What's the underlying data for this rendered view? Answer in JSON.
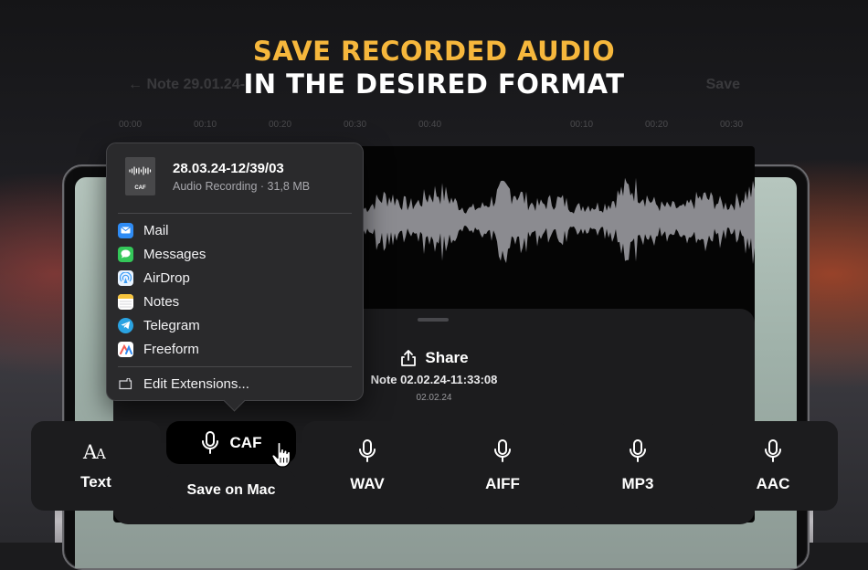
{
  "headline": {
    "line1": "SAVE RECORDED AUDIO",
    "line2": "IN THE DESIRED FORMAT"
  },
  "topbar": {
    "back_label": "← Note 29.01.24-",
    "save_label": "Save"
  },
  "timeline": [
    "00:00",
    "00:10",
    "00:20",
    "00:30",
    "00:40",
    "00:10",
    "00:20",
    "00:30"
  ],
  "sheet": {
    "share_label": "Share",
    "note_title": "Note 02.02.24-11:33:08",
    "note_date": "02.02.24"
  },
  "popover": {
    "file_name": "28.03.24-12/39/03",
    "file_meta": "Audio Recording · 31,8 MB",
    "file_ext": "CAF",
    "items": [
      {
        "label": "Mail",
        "icon": "mail-icon",
        "color": "#2f8cf5"
      },
      {
        "label": "Messages",
        "icon": "messages-icon",
        "color": "#34c759"
      },
      {
        "label": "AirDrop",
        "icon": "airdrop-icon",
        "color": "#3b9cf5"
      },
      {
        "label": "Notes",
        "icon": "notes-icon",
        "color": "#f6c33c"
      },
      {
        "label": "Telegram",
        "icon": "telegram-icon",
        "color": "#2aa3e2"
      },
      {
        "label": "Freeform",
        "icon": "freeform-icon",
        "color": "#ffffff"
      }
    ],
    "edit_label": "Edit Extensions..."
  },
  "formats": {
    "text_label": "Text",
    "caf_label": "CAF",
    "save_mac_label": "Save on Mac",
    "wav_label": "WAV",
    "aiff_label": "AIFF",
    "mp3_label": "MP3",
    "aac_label": "AAC"
  },
  "colors": {
    "accent": "#f6b73c",
    "panel": "#1c1c1e",
    "popover": "#2a2a2c"
  }
}
